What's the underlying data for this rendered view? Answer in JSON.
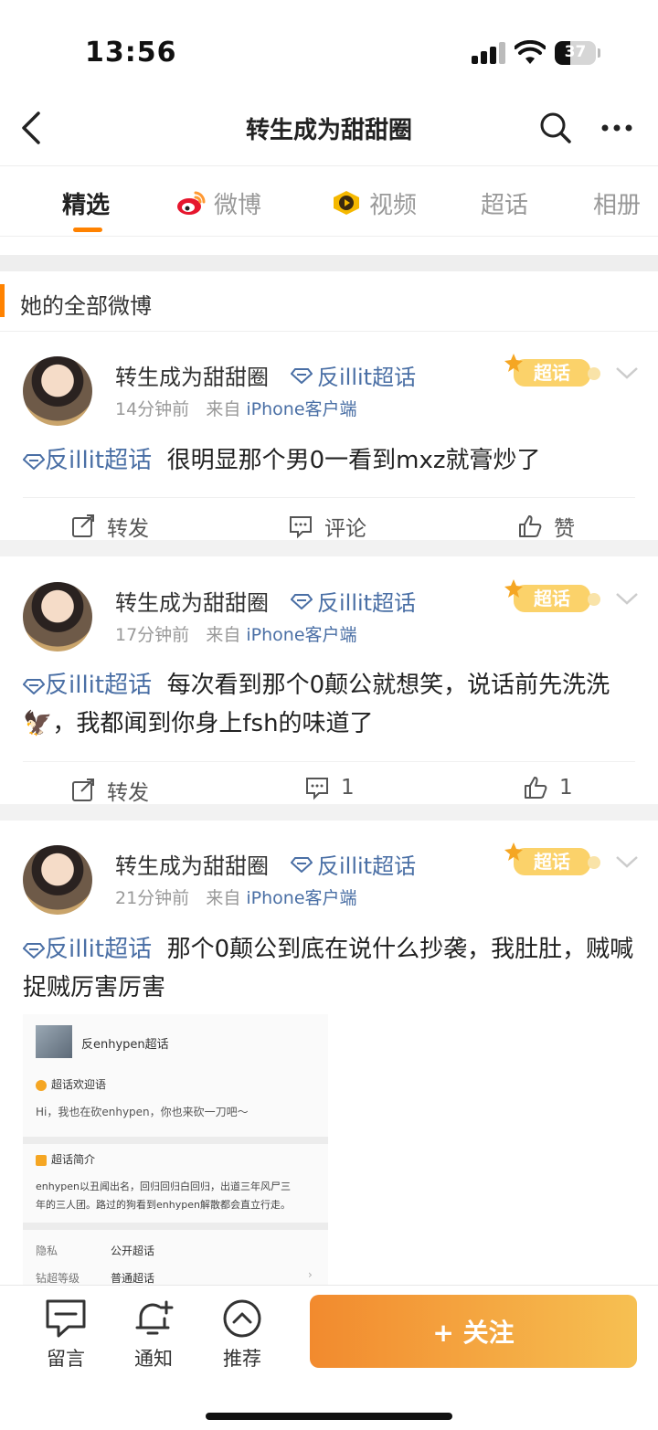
{
  "status_bar": {
    "time": "13:56",
    "battery": "37"
  },
  "nav": {
    "title": "转生成为甜甜圈"
  },
  "tabs": [
    {
      "label": "精选"
    },
    {
      "label": "微博"
    },
    {
      "label": "视频"
    },
    {
      "label": "超话"
    },
    {
      "label": "相册"
    }
  ],
  "section": {
    "title": "她的全部微博"
  },
  "posts": [
    {
      "author": "转生成为甜甜圈",
      "topic_tag": "反illit超话",
      "time": "14分钟前",
      "from_label": "来自",
      "source": "iPhone客户端",
      "badge": "超话",
      "topic": "反illit超话",
      "text": "很明显那个男0一看到mxz就膏炒了",
      "repost": "转发",
      "comment": "评论",
      "like": "赞"
    },
    {
      "author": "转生成为甜甜圈",
      "topic_tag": "反illit超话",
      "time": "17分钟前",
      "from_label": "来自",
      "source": "iPhone客户端",
      "badge": "超话",
      "topic": "反illit超话",
      "text": "每次看到那个0颠公就想笑，说话前先洗洗🦅，我都闻到你身上fsh的味道了",
      "repost": "转发",
      "comment": "1",
      "like": "1"
    },
    {
      "author": "转生成为甜甜圈",
      "topic_tag": "反illit超话",
      "time": "21分钟前",
      "from_label": "来自",
      "source": "iPhone客户端",
      "badge": "超话",
      "topic": "反illit超话",
      "text": "那个0颠公到底在说什么抄袭，我肚肚，贼喊捉贼厉害厉害",
      "image": {
        "name": "反enhypen超话",
        "welcome_title": "超话欢迎语",
        "welcome_text": "Hi，我也在砍enhypen，你也来砍一刀吧～",
        "intro_title": "超话简介",
        "intro_text_1": "enhypen以丑闻出名，回归回归白回归，出道三年风尸三",
        "intro_text_2": "年的三人团。路过的狗看到enhypen解散都会直立行走。",
        "privacy_label": "隐私",
        "privacy_value": "公开超话",
        "level_label": "钻超等级",
        "level_value": "普通超话"
      }
    }
  ],
  "bottom": {
    "message": "留言",
    "notify": "通知",
    "recommend": "推荐",
    "follow": "+ 关注"
  }
}
